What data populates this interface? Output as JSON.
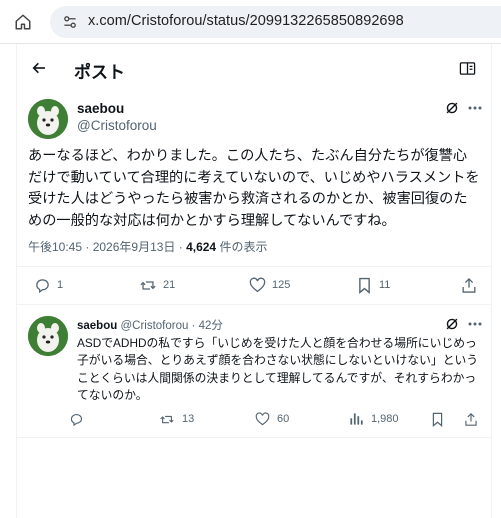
{
  "browser": {
    "url": "x.com/Cristoforou/status/2099132265850892698"
  },
  "header": {
    "title": "ポスト"
  },
  "main_post": {
    "name": "saebou",
    "handle": "@Cristoforou",
    "text": "あーなるほど、わかりました。この人たち、たぶん自分たちが復讐心だけで動いていて合理的に考えていないので、いじめやハラスメントを受けた人はどうやったら被害から救済されるのかとか、被害回復のための一般的な対応は何かとかすら理解してないんですね。",
    "time": "午後10:45 · 2026年9月13日 · ",
    "views": "4,624",
    "views_label": " 件の表示",
    "stats": {
      "replies": "1",
      "reposts": "21",
      "likes": "125",
      "bookmarks": "11"
    }
  },
  "reply_post": {
    "name": "saebou",
    "handle": "@Cristoforou",
    "age": "42分",
    "text": "ASDでADHDの私ですら「いじめを受けた人と顔を合わせる場所にいじめっ子がいる場合、とりあえず顔を合わさない状態にしないといけない」ということくらいは人間関係の決まりとして理解してるんですが、それすらわかってないのか。",
    "stats": {
      "reposts": "13",
      "likes": "60",
      "views": "1,980"
    }
  },
  "icons": {
    "home": "home-icon",
    "site_info": "site-settings-icon",
    "back": "arrow-left-icon",
    "reader": "reader-icon",
    "grok": "grok-icon",
    "more": "more-icon",
    "reply": "reply-icon",
    "repost": "repost-icon",
    "like": "heart-icon",
    "bookmark": "bookmark-icon",
    "share": "share-icon",
    "analytics": "analytics-icon"
  },
  "colors": {
    "text": "#0f1419",
    "secondary": "#536471",
    "border": "#eff3f4",
    "url_bar": "#eef1f5"
  }
}
